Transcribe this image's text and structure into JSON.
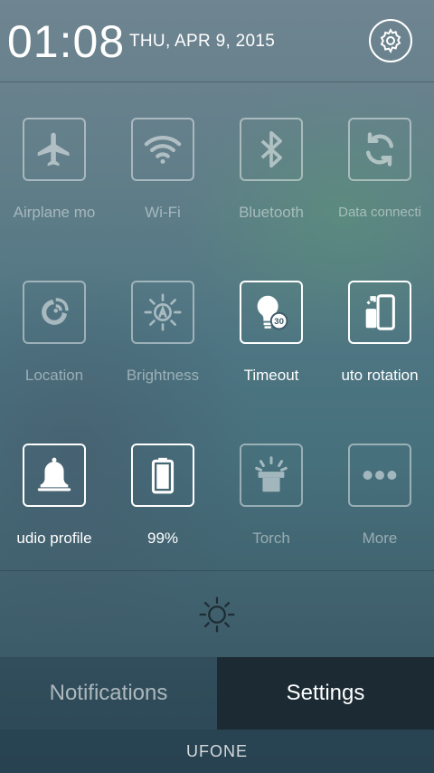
{
  "header": {
    "time": "01:08",
    "date": "THU, APR 9, 2015"
  },
  "tiles": [
    {
      "label": "Airplane mo",
      "icon": "airplane-icon",
      "active": false
    },
    {
      "label": "Wi-Fi",
      "icon": "wifi-icon",
      "active": false
    },
    {
      "label": "Bluetooth",
      "icon": "bluetooth-icon",
      "active": false
    },
    {
      "label": "Data connecti",
      "icon": "sync-icon",
      "active": false
    },
    {
      "label": "Location",
      "icon": "location-icon",
      "active": false
    },
    {
      "label": "Brightness",
      "icon": "brightness-icon",
      "active": false
    },
    {
      "label": "Timeout",
      "icon": "timeout-bulb-icon",
      "badge": "30",
      "active": true
    },
    {
      "label": "uto rotation",
      "icon": "auto-rotation-icon",
      "active": true
    },
    {
      "label": "udio profile",
      "icon": "bell-icon",
      "active": true
    },
    {
      "label": "99%",
      "icon": "battery-icon",
      "active": true
    },
    {
      "label": "Torch",
      "icon": "torch-icon",
      "active": false
    },
    {
      "label": "More",
      "icon": "more-icon",
      "active": false
    }
  ],
  "tabs": {
    "notifications": "Notifications",
    "settings": "Settings"
  },
  "carrier": "UFONE",
  "colors": {
    "active_tab_bg": "#1b2a33",
    "inactive_tile": "rgba(255,255,255,0.45)",
    "active_tile": "#ffffff"
  }
}
